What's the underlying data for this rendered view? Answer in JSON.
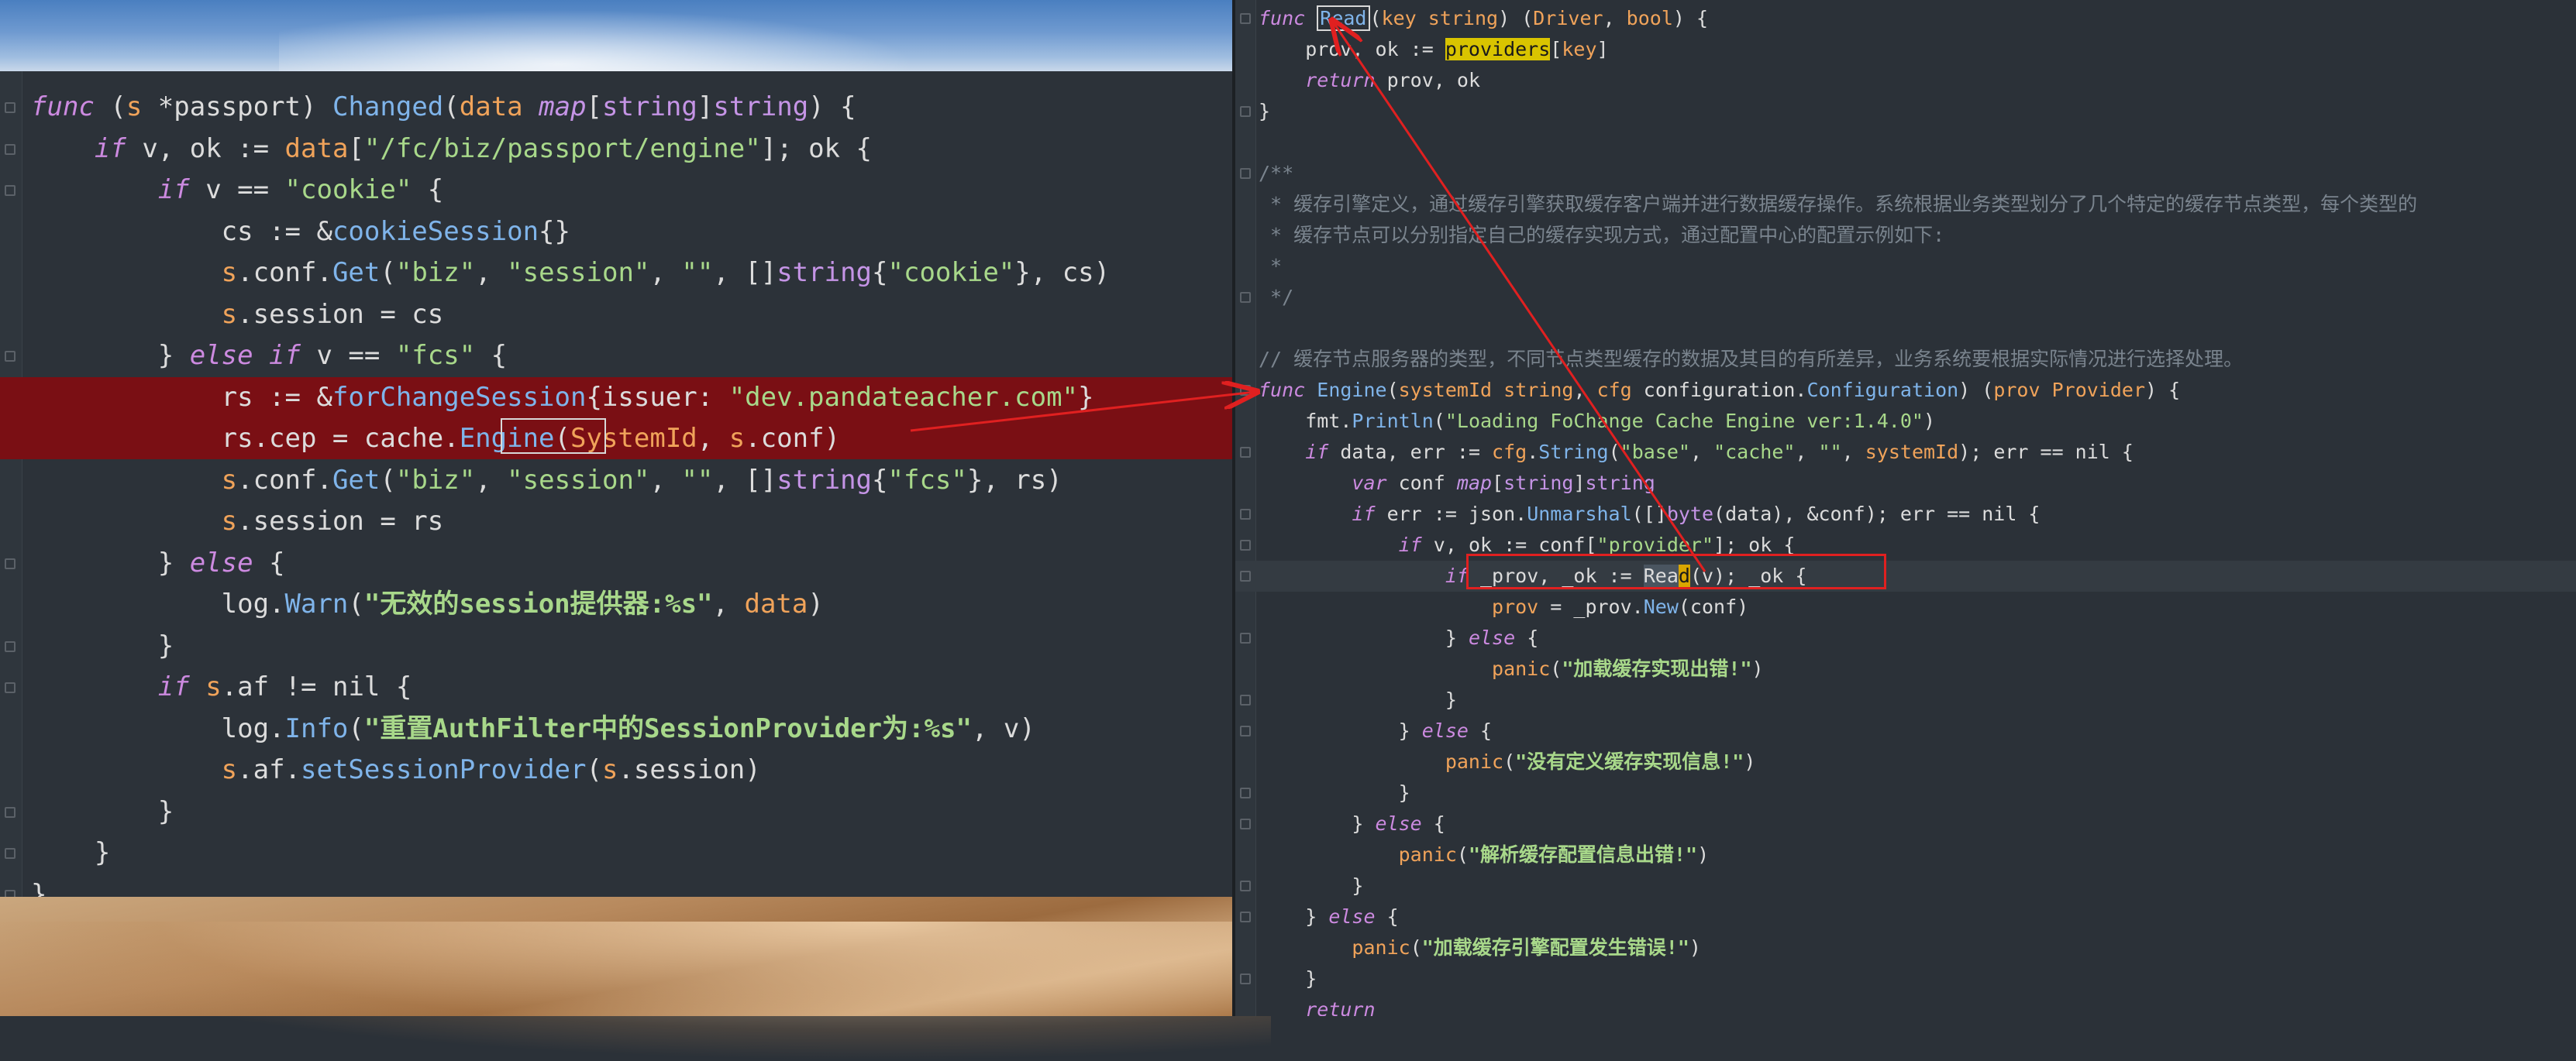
{
  "left_editor": {
    "lines": [
      {
        "tokens": [
          [
            "kw",
            "func"
          ],
          [
            "var",
            " ("
          ],
          [
            "rcv",
            "s"
          ],
          [
            "var",
            " *passport) "
          ],
          [
            "fn",
            "Changed"
          ],
          [
            "var",
            "("
          ],
          [
            "rcv",
            "data"
          ],
          [
            "var",
            " "
          ],
          [
            "tyi",
            "map"
          ],
          [
            "var",
            "["
          ],
          [
            "ty",
            "string"
          ],
          [
            "var",
            "]"
          ],
          [
            "ty",
            "string"
          ],
          [
            "var",
            ") {"
          ]
        ]
      },
      {
        "tokens": [
          [
            "var",
            "    "
          ],
          [
            "kw",
            "if"
          ],
          [
            "var",
            " v, ok := "
          ],
          [
            "rcv",
            "data"
          ],
          [
            "var",
            "["
          ],
          [
            "str",
            "\"/fc/biz/passport/engine\""
          ],
          [
            "var",
            "]; ok {"
          ]
        ]
      },
      {
        "tokens": [
          [
            "var",
            "        "
          ],
          [
            "kw",
            "if"
          ],
          [
            "var",
            " v == "
          ],
          [
            "str",
            "\"cookie\""
          ],
          [
            "var",
            " {"
          ]
        ]
      },
      {
        "tokens": [
          [
            "var",
            "            cs := &"
          ],
          [
            "fn",
            "cookieSession"
          ],
          [
            "var",
            "{}"
          ]
        ]
      },
      {
        "tokens": [
          [
            "var",
            "            "
          ],
          [
            "rcv",
            "s"
          ],
          [
            "var",
            ".conf."
          ],
          [
            "fn",
            "Get"
          ],
          [
            "var",
            "("
          ],
          [
            "str",
            "\"biz\""
          ],
          [
            "var",
            ", "
          ],
          [
            "str",
            "\"session\""
          ],
          [
            "var",
            ", "
          ],
          [
            "str",
            "\"\""
          ],
          [
            "var",
            ", []"
          ],
          [
            "ty",
            "string"
          ],
          [
            "var",
            "{"
          ],
          [
            "str",
            "\"cookie\""
          ],
          [
            "var",
            "}, cs)"
          ]
        ]
      },
      {
        "tokens": [
          [
            "var",
            "            "
          ],
          [
            "rcv",
            "s"
          ],
          [
            "var",
            ".session = cs"
          ]
        ]
      },
      {
        "tokens": [
          [
            "var",
            "        } "
          ],
          [
            "kw",
            "else if"
          ],
          [
            "var",
            " v == "
          ],
          [
            "str",
            "\"fcs\""
          ],
          [
            "var",
            " {"
          ]
        ]
      },
      {
        "tokens": [
          [
            "var",
            "            rs := &"
          ],
          [
            "fn",
            "forChangeSession"
          ],
          [
            "var",
            "{issuer: "
          ],
          [
            "str",
            "\"dev.pandateacher.com\""
          ],
          [
            "var",
            "}"
          ]
        ]
      },
      {
        "tokens": [
          [
            "var",
            "            rs.cep = cache."
          ],
          [
            "fn",
            "Engine"
          ],
          [
            "var",
            "("
          ],
          [
            "rcv",
            "SystemId"
          ],
          [
            "var",
            ", "
          ],
          [
            "rcv",
            "s"
          ],
          [
            "var",
            ".conf)"
          ]
        ]
      },
      {
        "tokens": [
          [
            "var",
            "            "
          ],
          [
            "rcv",
            "s"
          ],
          [
            "var",
            ".conf."
          ],
          [
            "fn",
            "Get"
          ],
          [
            "var",
            "("
          ],
          [
            "str",
            "\"biz\""
          ],
          [
            "var",
            ", "
          ],
          [
            "str",
            "\"session\""
          ],
          [
            "var",
            ", "
          ],
          [
            "str",
            "\"\""
          ],
          [
            "var",
            ", []"
          ],
          [
            "ty",
            "string"
          ],
          [
            "var",
            "{"
          ],
          [
            "str",
            "\"fcs\""
          ],
          [
            "var",
            "}, rs)"
          ]
        ]
      },
      {
        "tokens": [
          [
            "var",
            "            "
          ],
          [
            "rcv",
            "s"
          ],
          [
            "var",
            ".session = rs"
          ]
        ]
      },
      {
        "tokens": [
          [
            "var",
            "        } "
          ],
          [
            "kw",
            "else"
          ],
          [
            "var",
            " {"
          ]
        ]
      },
      {
        "tokens": [
          [
            "var",
            "            log."
          ],
          [
            "fn",
            "Warn"
          ],
          [
            "var",
            "("
          ],
          [
            "strb",
            "\"无效的session提供器:%s\""
          ],
          [
            "var",
            ", "
          ],
          [
            "rcv",
            "data"
          ],
          [
            "var",
            ")"
          ]
        ]
      },
      {
        "tokens": [
          [
            "var",
            "        }"
          ]
        ]
      },
      {
        "tokens": [
          [
            "var",
            "        "
          ],
          [
            "kw",
            "if"
          ],
          [
            "var",
            " "
          ],
          [
            "rcv",
            "s"
          ],
          [
            "var",
            ".af != nil {"
          ]
        ]
      },
      {
        "tokens": [
          [
            "var",
            "            log."
          ],
          [
            "fn",
            "Info"
          ],
          [
            "var",
            "("
          ],
          [
            "strb",
            "\"重置AuthFilter中的SessionProvider为:%s\""
          ],
          [
            "var",
            ", v)"
          ]
        ]
      },
      {
        "tokens": [
          [
            "var",
            "            "
          ],
          [
            "rcv",
            "s"
          ],
          [
            "var",
            ".af."
          ],
          [
            "fn",
            "setSessionProvider"
          ],
          [
            "var",
            "("
          ],
          [
            "rcv",
            "s"
          ],
          [
            "var",
            ".session)"
          ]
        ]
      },
      {
        "tokens": [
          [
            "var",
            "        }"
          ]
        ]
      },
      {
        "tokens": [
          [
            "var",
            "    }"
          ]
        ]
      },
      {
        "tokens": [
          [
            "var",
            "}"
          ]
        ]
      }
    ]
  },
  "right_editor": {
    "lines": [
      {
        "tokens": [
          [
            "kw",
            "func"
          ],
          [
            "var",
            " "
          ],
          [
            "fnread",
            "Read"
          ],
          [
            "var",
            "("
          ],
          [
            "rcv",
            "key"
          ],
          [
            "var",
            " "
          ],
          [
            "rcv",
            "string"
          ],
          [
            "var",
            ") ("
          ],
          [
            "rcv",
            "Driver"
          ],
          [
            "var",
            ", "
          ],
          [
            "rcv",
            "bool"
          ],
          [
            "var",
            ") {"
          ]
        ]
      },
      {
        "tokens": [
          [
            "var",
            "    prov, ok := "
          ],
          [
            "yellow",
            "providers"
          ],
          [
            "var",
            "["
          ],
          [
            "rcv",
            "key"
          ],
          [
            "var",
            "]"
          ]
        ]
      },
      {
        "tokens": [
          [
            "var",
            "    "
          ],
          [
            "kw",
            "return"
          ],
          [
            "var",
            " prov, ok"
          ]
        ]
      },
      {
        "tokens": [
          [
            "var",
            "}"
          ]
        ]
      },
      {
        "tokens": [
          [
            "var",
            ""
          ]
        ]
      },
      {
        "tokens": [
          [
            "cmt",
            "/**"
          ]
        ]
      },
      {
        "tokens": [
          [
            "cmt",
            " * 缓存引擎定义，通过缓存引擎获取缓存客户端并进行数据缓存操作。系统根据业务类型划分了几个特定的缓存节点类型，每个类型的"
          ]
        ]
      },
      {
        "tokens": [
          [
            "cmt",
            " * 缓存节点可以分别指定自己的缓存实现方式，通过配置中心的配置示例如下:"
          ]
        ]
      },
      {
        "tokens": [
          [
            "cmt",
            " *"
          ]
        ]
      },
      {
        "tokens": [
          [
            "cmt",
            " */"
          ]
        ]
      },
      {
        "tokens": [
          [
            "var",
            ""
          ]
        ]
      },
      {
        "tokens": [
          [
            "cmt",
            "// 缓存节点服务器的类型，不同节点类型缓存的数据及其目的有所差异，业务系统要根据实际情况进行选择处理。"
          ]
        ]
      },
      {
        "tokens": [
          [
            "kw",
            "func"
          ],
          [
            "var",
            " "
          ],
          [
            "fn",
            "Engine"
          ],
          [
            "var",
            "("
          ],
          [
            "rcv",
            "systemId"
          ],
          [
            "var",
            " "
          ],
          [
            "rcv",
            "string"
          ],
          [
            "var",
            ", "
          ],
          [
            "rcv",
            "cfg"
          ],
          [
            "var",
            " configuration."
          ],
          [
            "fn",
            "Configuration"
          ],
          [
            "var",
            ") ("
          ],
          [
            "rcv",
            "prov"
          ],
          [
            "var",
            " "
          ],
          [
            "rcv",
            "Provider"
          ],
          [
            "var",
            ") {"
          ]
        ]
      },
      {
        "tokens": [
          [
            "var",
            "    fmt."
          ],
          [
            "fn",
            "Println"
          ],
          [
            "var",
            "("
          ],
          [
            "str",
            "\"Loading FoChange Cache Engine ver:1.4.0\""
          ],
          [
            "var",
            ")"
          ]
        ]
      },
      {
        "tokens": [
          [
            "var",
            "    "
          ],
          [
            "kw",
            "if"
          ],
          [
            "var",
            " data, err := "
          ],
          [
            "rcv",
            "cfg"
          ],
          [
            "var",
            "."
          ],
          [
            "fn",
            "String"
          ],
          [
            "var",
            "("
          ],
          [
            "str",
            "\"base\""
          ],
          [
            "var",
            ", "
          ],
          [
            "str",
            "\"cache\""
          ],
          [
            "var",
            ", "
          ],
          [
            "str",
            "\"\""
          ],
          [
            "var",
            ", "
          ],
          [
            "rcv",
            "systemId"
          ],
          [
            "var",
            "); err == nil {"
          ]
        ]
      },
      {
        "tokens": [
          [
            "var",
            "        "
          ],
          [
            "kw",
            "var"
          ],
          [
            "var",
            " conf "
          ],
          [
            "tyi",
            "map"
          ],
          [
            "var",
            "["
          ],
          [
            "ty",
            "string"
          ],
          [
            "var",
            "]"
          ],
          [
            "ty",
            "string"
          ]
        ]
      },
      {
        "tokens": [
          [
            "var",
            "        "
          ],
          [
            "kw",
            "if"
          ],
          [
            "var",
            " err := json."
          ],
          [
            "fn",
            "Unmarshal"
          ],
          [
            "var",
            "([]"
          ],
          [
            "ty",
            "byte"
          ],
          [
            "var",
            "(data), &conf); err == nil {"
          ]
        ]
      },
      {
        "tokens": [
          [
            "var",
            "            "
          ],
          [
            "kw",
            "if"
          ],
          [
            "var",
            " v, ok := conf["
          ],
          [
            "str",
            "\"provider\""
          ],
          [
            "var",
            "]; ok {"
          ]
        ]
      },
      {
        "tokens": [
          [
            "var",
            "                "
          ],
          [
            "kw",
            "if"
          ],
          [
            "var",
            " _prov, _ok := "
          ],
          [
            "readcaret",
            "Read"
          ],
          [
            "var",
            "(v); _ok {"
          ]
        ]
      },
      {
        "tokens": [
          [
            "var",
            "                    "
          ],
          [
            "rcv",
            "prov"
          ],
          [
            "var",
            " = _prov."
          ],
          [
            "fn",
            "New"
          ],
          [
            "var",
            "(conf)"
          ]
        ]
      },
      {
        "tokens": [
          [
            "var",
            "                } "
          ],
          [
            "kw",
            "else"
          ],
          [
            "var",
            " {"
          ]
        ]
      },
      {
        "tokens": [
          [
            "var",
            "                    "
          ],
          [
            "panicfn",
            "panic"
          ],
          [
            "var",
            "("
          ],
          [
            "strb",
            "\"加载缓存实现出错!\""
          ],
          [
            "var",
            ")"
          ]
        ]
      },
      {
        "tokens": [
          [
            "var",
            "                }"
          ]
        ]
      },
      {
        "tokens": [
          [
            "var",
            "            } "
          ],
          [
            "kw",
            "else"
          ],
          [
            "var",
            " {"
          ]
        ]
      },
      {
        "tokens": [
          [
            "var",
            "                "
          ],
          [
            "panicfn",
            "panic"
          ],
          [
            "var",
            "("
          ],
          [
            "strb",
            "\"没有定义缓存实现信息!\""
          ],
          [
            "var",
            ")"
          ]
        ]
      },
      {
        "tokens": [
          [
            "var",
            "            }"
          ]
        ]
      },
      {
        "tokens": [
          [
            "var",
            "        } "
          ],
          [
            "kw",
            "else"
          ],
          [
            "var",
            " {"
          ]
        ]
      },
      {
        "tokens": [
          [
            "var",
            "            "
          ],
          [
            "panicfn",
            "panic"
          ],
          [
            "var",
            "("
          ],
          [
            "strb",
            "\"解析缓存配置信息出错!\""
          ],
          [
            "var",
            ")"
          ]
        ]
      },
      {
        "tokens": [
          [
            "var",
            "        }"
          ]
        ]
      },
      {
        "tokens": [
          [
            "var",
            "    } "
          ],
          [
            "kw",
            "else"
          ],
          [
            "var",
            " {"
          ]
        ]
      },
      {
        "tokens": [
          [
            "var",
            "        "
          ],
          [
            "panicfn",
            "panic"
          ],
          [
            "var",
            "("
          ],
          [
            "strb",
            "\"加载缓存引擎配置发生错误!\""
          ],
          [
            "var",
            ")"
          ]
        ]
      },
      {
        "tokens": [
          [
            "var",
            "    }"
          ]
        ]
      },
      {
        "tokens": [
          [
            "var",
            "    "
          ],
          [
            "kw",
            "return"
          ]
        ]
      }
    ]
  },
  "colors": {
    "highlight_red": "#7a0f14",
    "annotation_red": "#e02020",
    "search_yellow": "#d9c400"
  }
}
